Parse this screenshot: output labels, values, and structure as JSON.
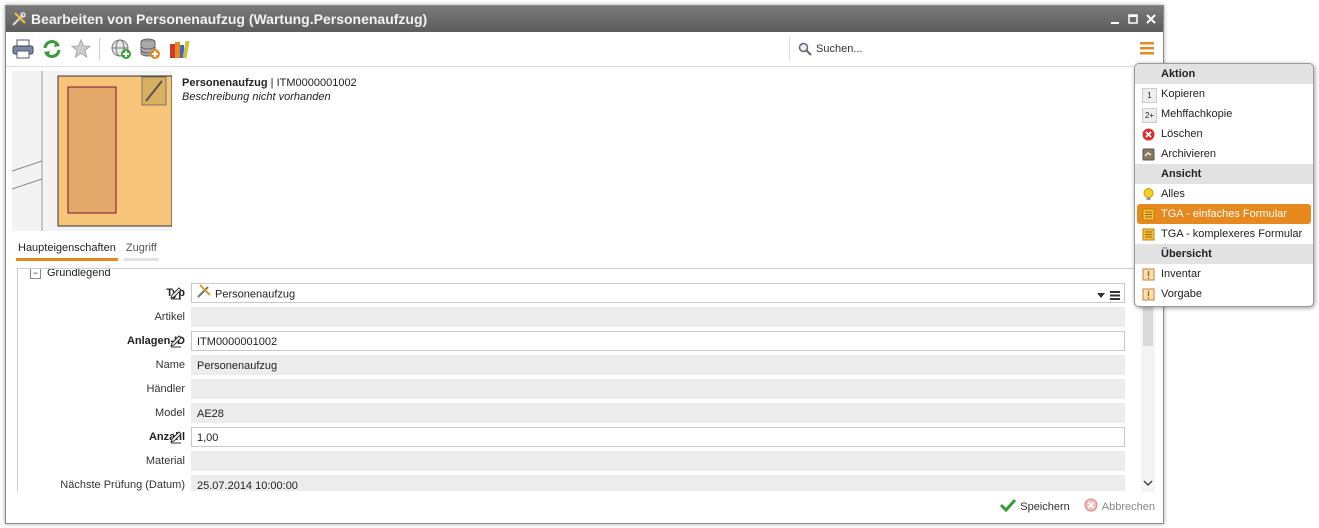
{
  "window": {
    "title": "Bearbeiten von Personenaufzug (Wartung.Personenaufzug)",
    "controls": [
      "minimize-icon",
      "maximize-icon",
      "close-icon"
    ]
  },
  "toolbar": {
    "buttons": [
      "print-icon",
      "refresh-icon",
      "favorite-star-icon",
      "add-globe-icon",
      "add-database-icon",
      "books-icon"
    ],
    "search_placeholder": "Suchen..."
  },
  "header": {
    "name": "Personenaufzug",
    "separator": " | ",
    "id": "ITM0000001002",
    "description": "Beschreibung nicht vorhanden"
  },
  "tabs": [
    {
      "label": "Haupteigenschaften",
      "active": true
    },
    {
      "label": "Zugriff",
      "active": false
    }
  ],
  "section": {
    "label": "Grundlegend",
    "toggle": "−"
  },
  "fields": [
    {
      "label": "Typ",
      "value": "Personenaufzug",
      "required": true,
      "editable": true
    },
    {
      "label": "Artikel",
      "value": "",
      "required": false,
      "editable": false
    },
    {
      "label": "Anlagen-ID",
      "value": "ITM0000001002",
      "required": true,
      "editable": true
    },
    {
      "label": "Name",
      "value": "Personenaufzug",
      "required": false,
      "editable": false
    },
    {
      "label": "Händler",
      "value": "",
      "required": false,
      "editable": false
    },
    {
      "label": "Model",
      "value": "AE28",
      "required": false,
      "editable": false
    },
    {
      "label": "Anzahl",
      "value": "1,00",
      "required": true,
      "editable": true
    },
    {
      "label": "Material",
      "value": "",
      "required": false,
      "editable": false
    },
    {
      "label": "Nächste Prüfung (Datum)",
      "value": "25.07.2014 10:00:00",
      "required": false,
      "editable": false
    }
  ],
  "footer": {
    "save": "Speichern",
    "cancel": "Abbrechen"
  },
  "menu": {
    "sections": [
      {
        "title": "Aktion",
        "items": [
          {
            "label": "Kopieren",
            "icon": "1"
          },
          {
            "label": "Mehffachkopie",
            "icon": "2+"
          },
          {
            "label": "Löschen",
            "icon": "delete-icon"
          },
          {
            "label": "Archivieren",
            "icon": "archive-icon"
          }
        ]
      },
      {
        "title": "Ansicht",
        "items": [
          {
            "label": "Alles",
            "icon": "lightbulb-icon"
          },
          {
            "label": "TGA - einfaches Formular",
            "icon": "form-icon",
            "selected": true
          },
          {
            "label": "TGA - komplexeres Formular",
            "icon": "form-icon"
          }
        ]
      },
      {
        "title": "Übersicht",
        "items": [
          {
            "label": "Inventar",
            "icon": "overview-icon"
          },
          {
            "label": "Vorgabe",
            "icon": "overview-icon"
          }
        ]
      }
    ]
  },
  "colors": {
    "accent": "#e8891f",
    "titlebar": "#6a6a6a",
    "section_bg": "#e2e2e2",
    "readonly_field": "#ececec"
  }
}
